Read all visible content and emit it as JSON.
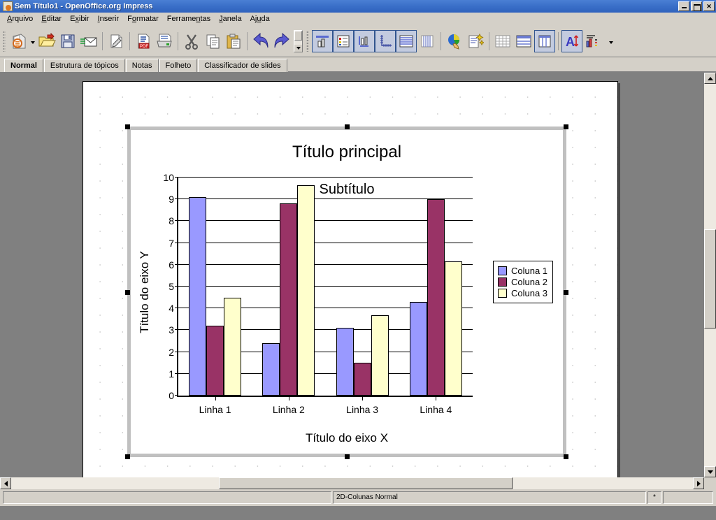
{
  "window": {
    "title": "Sem Título1 - OpenOffice.org Impress",
    "app_icon": "impress-icon",
    "buttons": {
      "minimize": "–",
      "maximize": "❐",
      "close": "×"
    }
  },
  "menu": {
    "items": [
      {
        "label": "Arquivo",
        "accel": "A"
      },
      {
        "label": "Editar",
        "accel": "E"
      },
      {
        "label": "Exibir",
        "accel": "x"
      },
      {
        "label": "Inserir",
        "accel": "I"
      },
      {
        "label": "Formatar",
        "accel": "o"
      },
      {
        "label": "Ferramentas",
        "accel": "n"
      },
      {
        "label": "Janela",
        "accel": "J"
      },
      {
        "label": "Ajuda",
        "accel": "u"
      }
    ]
  },
  "toolbar": {
    "buttons": [
      {
        "name": "new-document-icon",
        "tip": "Novo"
      },
      {
        "name": "new-dropdown-icon",
        "tip": "Novo (lista)"
      },
      {
        "name": "open-folder-icon",
        "tip": "Abrir"
      },
      {
        "name": "save-icon",
        "tip": "Salvar"
      },
      {
        "name": "email-document-icon",
        "tip": "Documento como e-mail"
      },
      {
        "name": "edit-file-icon",
        "tip": "Editar arquivo"
      },
      {
        "name": "export-pdf-icon",
        "tip": "Exportar diretamente como PDF"
      },
      {
        "name": "print-icon",
        "tip": "Imprimir arquivo diretamente"
      },
      {
        "name": "cut-icon",
        "tip": "Cortar"
      },
      {
        "name": "copy-icon",
        "tip": "Copiar"
      },
      {
        "name": "paste-icon",
        "tip": "Colar"
      },
      {
        "name": "undo-icon",
        "tip": "Desfazer"
      },
      {
        "name": "redo-icon",
        "tip": "Refazer"
      },
      {
        "name": "chart-type-icon",
        "tip": "Tipo de gráfico"
      },
      {
        "name": "chart-data-table-icon",
        "tip": "Tabela de dados do gráfico"
      },
      {
        "name": "chart-titles-icon",
        "tip": "Títulos"
      },
      {
        "name": "chart-axes-icon",
        "tip": "Eixos"
      },
      {
        "name": "horizontal-grids-icon",
        "tip": "Grades horizontais"
      },
      {
        "name": "vertical-grids-icon",
        "tip": "Grades verticais"
      },
      {
        "name": "pie-chart-hand-icon",
        "tip": "Inserir gráfico"
      },
      {
        "name": "autoformat-icon",
        "tip": "AutoFormatação"
      },
      {
        "name": "table-grid-icon",
        "tip": "Tabela"
      },
      {
        "name": "legend-rows-icon",
        "tip": "Legenda"
      },
      {
        "name": "data-in-columns-icon",
        "tip": "Dados em colunas"
      },
      {
        "name": "scale-text-icon",
        "tip": "Escalonar texto"
      },
      {
        "name": "chart-statistics-icon",
        "tip": "Estatísticas"
      }
    ]
  },
  "view_tabs": {
    "items": [
      {
        "label": "Normal",
        "active": true
      },
      {
        "label": "Estrutura de tópicos",
        "active": false
      },
      {
        "label": "Notas",
        "active": false
      },
      {
        "label": "Folheto",
        "active": false
      },
      {
        "label": "Classificador de slides",
        "active": false
      }
    ]
  },
  "chart_data": {
    "type": "bar",
    "title": "Título principal",
    "subtitle": "Subtítulo",
    "xlabel": "Título do eixo X",
    "ylabel": "Título do eixo Y",
    "categories": [
      "Linha 1",
      "Linha 2",
      "Linha 3",
      "Linha 4"
    ],
    "series": [
      {
        "name": "Coluna 1",
        "color": "#9999ff",
        "values": [
          9.1,
          2.4,
          3.1,
          4.3
        ]
      },
      {
        "name": "Coluna 2",
        "color": "#993366",
        "values": [
          3.2,
          8.8,
          1.5,
          9.0
        ]
      },
      {
        "name": "Coluna 3",
        "color": "#ffffcc",
        "values": [
          4.5,
          9.65,
          3.7,
          6.15
        ]
      }
    ],
    "ylim": [
      0,
      10
    ],
    "yticks": [
      0,
      1,
      2,
      3,
      4,
      5,
      6,
      7,
      8,
      9,
      10
    ],
    "grid": true,
    "legend_position": "right"
  },
  "statusbar": {
    "left": "",
    "object_info": "2D-Colunas Normal",
    "modified": "*",
    "right": ""
  }
}
